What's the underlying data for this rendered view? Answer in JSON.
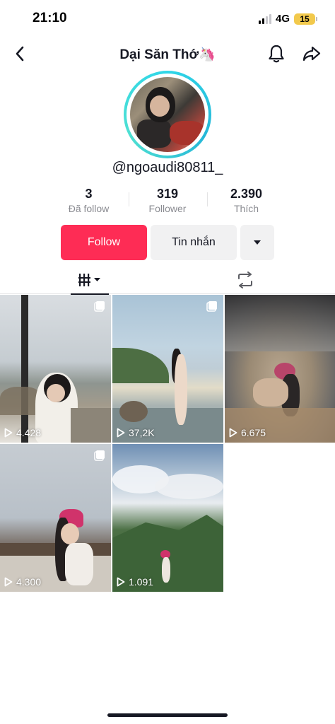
{
  "status_bar": {
    "time": "21:10",
    "network": "4G",
    "battery": "15"
  },
  "nav": {
    "title": "Dại Săn Thớ🦄"
  },
  "profile": {
    "username": "@ngoaudi80811_",
    "stats": [
      {
        "value": "3",
        "label": "Đã follow"
      },
      {
        "value": "319",
        "label": "Follower"
      },
      {
        "value": "2.390",
        "label": "Thích"
      }
    ]
  },
  "actions": {
    "follow": "Follow",
    "message": "Tin nhắn"
  },
  "videos": [
    {
      "views": "4.428",
      "multi_image": true
    },
    {
      "views": "37,2K",
      "multi_image": true
    },
    {
      "views": "6.675",
      "multi_image": false
    },
    {
      "views": "4.300",
      "multi_image": true
    },
    {
      "views": "1.091",
      "multi_image": false
    }
  ],
  "colors": {
    "accent": "#fe2c55",
    "avatar_ring": "#2fd6e8"
  }
}
